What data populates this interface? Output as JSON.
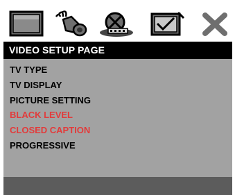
{
  "tabs": [
    {
      "icon": "general-setup-icon",
      "selected": false
    },
    {
      "icon": "audio-setup-icon",
      "selected": false
    },
    {
      "icon": "video-setup-icon",
      "selected": true
    },
    {
      "icon": "preference-icon",
      "selected": false
    },
    {
      "icon": "exit-icon",
      "selected": false
    }
  ],
  "page_title": "VIDEO SETUP PAGE",
  "menu": {
    "items": [
      {
        "label": "TV TYPE",
        "enabled": true
      },
      {
        "label": "TV DISPLAY",
        "enabled": true
      },
      {
        "label": "PICTURE SETTING",
        "enabled": true
      },
      {
        "label": "BLACK LEVEL",
        "enabled": false
      },
      {
        "label": "CLOSED CAPTION",
        "enabled": false
      },
      {
        "label": "PROGRESSIVE",
        "enabled": true
      }
    ]
  },
  "colors": {
    "header_bg": "#000000",
    "panel_bg": "#a2a2a2",
    "footer_bg": "#5c5c5c",
    "disabled_text": "#e23b3b",
    "icon_gray": "#6f6f6f"
  }
}
